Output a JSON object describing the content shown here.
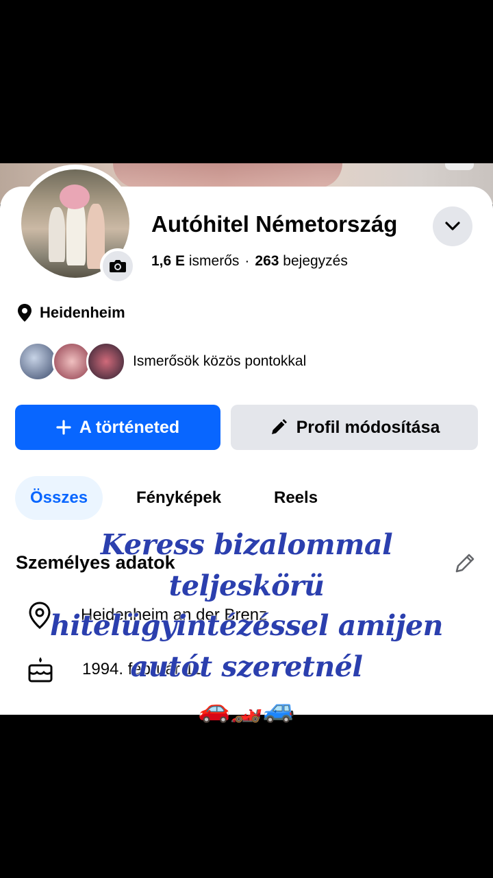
{
  "profile": {
    "name": "Autóhitel Németország",
    "friends_count": "1,6 E",
    "friends_label": "ismerős",
    "posts_count": "263",
    "posts_label": "bejegyzés",
    "location": "Heidenheim",
    "mutual_text": "Ismerősök közös pontokkal"
  },
  "buttons": {
    "story": "A történeted",
    "edit_profile": "Profil módosítása"
  },
  "tabs": [
    {
      "label": "Összes",
      "active": true
    },
    {
      "label": "Fényképek"
    },
    {
      "label": "Reels"
    }
  ],
  "personal": {
    "title": "Személyes adatok",
    "city": "Heidenheim an der Brenz",
    "birthday": "1994. február 11."
  },
  "overlay": {
    "line1": "Keress bizalommal",
    "line2": "teljeskörü",
    "line3": "hitelügyintézéssel amijen",
    "line4": "autót szeretnél",
    "emojis": "🚗🏎️🚙"
  },
  "colors": {
    "primary": "#0866ff",
    "secondary_bg": "#e4e6eb",
    "overlay_text": "#2b3fae"
  }
}
